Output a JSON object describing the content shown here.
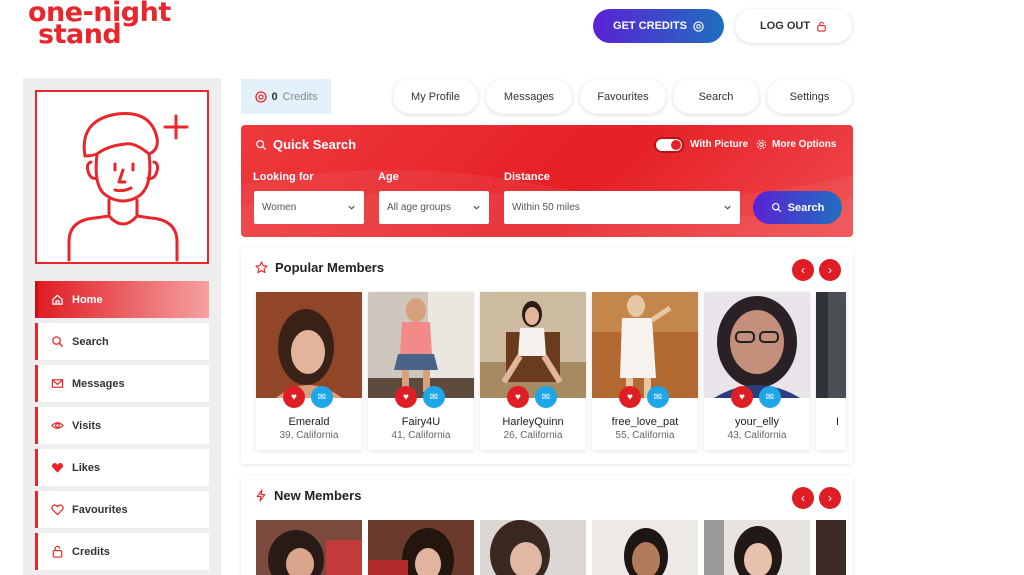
{
  "logo": {
    "line1": "one-night",
    "line2": "stand"
  },
  "header": {
    "credits_button": "GET CREDITS",
    "logout_button": "LOG OUT"
  },
  "sidebar": {
    "items": [
      {
        "label": "Home",
        "icon": "home-icon"
      },
      {
        "label": "Search",
        "icon": "search-icon"
      },
      {
        "label": "Messages",
        "icon": "mail-icon"
      },
      {
        "label": "Visits",
        "icon": "eye-icon"
      },
      {
        "label": "Likes",
        "icon": "heart-icon"
      },
      {
        "label": "Favourites",
        "icon": "heart-outline-icon"
      },
      {
        "label": "Credits",
        "icon": "lock-icon"
      }
    ]
  },
  "topbar": {
    "credits_count": "0",
    "credits_label": "Credits",
    "tabs": [
      "My Profile",
      "Messages",
      "Favourites",
      "Search",
      "Settings"
    ]
  },
  "quick_search": {
    "title": "Quick Search",
    "with_picture": "With Picture",
    "more_options": "More Options",
    "looking_for_label": "Looking for",
    "looking_for_value": "Women",
    "age_label": "Age",
    "age_value": "All age groups",
    "distance_label": "Distance",
    "distance_value": "Within 50 miles",
    "search_button": "Search"
  },
  "popular": {
    "title": "Popular Members",
    "members": [
      {
        "name": "Emerald",
        "location": "39, California"
      },
      {
        "name": "Fairy4U",
        "location": "41, California"
      },
      {
        "name": "HarleyQuinn",
        "location": "26, California"
      },
      {
        "name": "free_love_pat",
        "location": "55, California"
      },
      {
        "name": "your_elly",
        "location": "43, California"
      }
    ]
  },
  "new_members": {
    "title": "New Members"
  },
  "colors": {
    "brand_red": "#e8262b",
    "accent_purple": "#5b21d6",
    "accent_blue": "#1f6fbf",
    "chat_blue": "#1ea7e8"
  }
}
